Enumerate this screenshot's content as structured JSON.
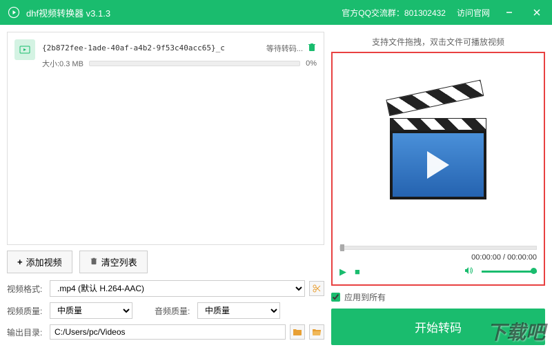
{
  "titlebar": {
    "title": "dhf视频转换器 v3.1.3",
    "qq_label": "官方QQ交流群：801302432",
    "website_label": "访问官网"
  },
  "file": {
    "name": "{2b872fee-1ade-40af-a4b2-9f53c40acc65}_c",
    "size_label": "大小:0.3 MB",
    "status": "等待转码...",
    "progress": "0%"
  },
  "buttons": {
    "add": "添加视频",
    "clear": "清空列表"
  },
  "settings": {
    "format_label": "视频格式:",
    "format_value": ".mp4 (默认 H.264-AAC)",
    "video_quality_label": "视频质量:",
    "video_quality_value": "中质量",
    "audio_quality_label": "音频质量:",
    "audio_quality_value": "中质量",
    "output_label": "输出目录:",
    "output_path": "C:/Users/pc/Videos"
  },
  "preview": {
    "header": "支持文件拖拽，双击文件可播放视频",
    "time_current": "00:00:00",
    "time_total": "00:00:00",
    "separator": " / "
  },
  "apply_all": "应用到所有",
  "start": "开始转码",
  "watermark": "下载吧"
}
